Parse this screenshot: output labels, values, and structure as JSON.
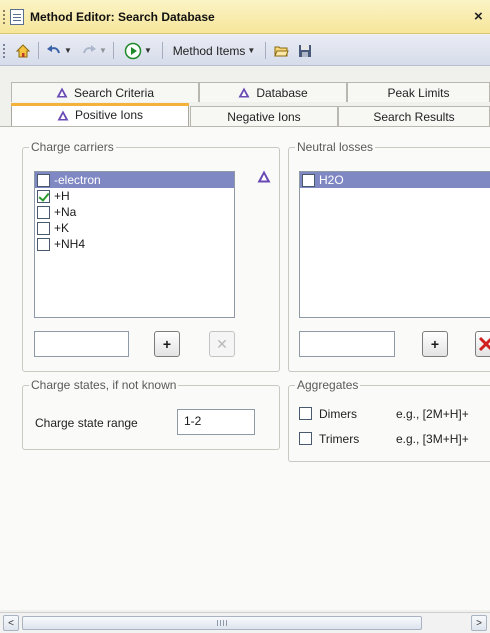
{
  "window": {
    "title": "Method Editor: Search Database",
    "close_glyph": "×"
  },
  "toolbar": {
    "method_items_label": "Method Items"
  },
  "tabs": {
    "row1": [
      {
        "label": "Search Criteria",
        "icon": "triangle-icon"
      },
      {
        "label": "Database",
        "icon": "triangle-icon"
      },
      {
        "label": "Peak Limits",
        "icon": ""
      }
    ],
    "row2": [
      {
        "label": "Positive Ions",
        "icon": "triangle-icon",
        "active": true
      },
      {
        "label": "Negative Ions",
        "icon": ""
      },
      {
        "label": "Search Results",
        "icon": ""
      }
    ]
  },
  "charge_carriers": {
    "legend": "Charge carriers",
    "items": [
      {
        "label": "-electron",
        "checked": false,
        "selected": true
      },
      {
        "label": "+H",
        "checked": true,
        "selected": false
      },
      {
        "label": "+Na",
        "checked": false,
        "selected": false
      },
      {
        "label": "+K",
        "checked": false,
        "selected": false
      },
      {
        "label": "+NH4",
        "checked": false,
        "selected": false
      }
    ],
    "input_value": "",
    "add_glyph": "+",
    "delete_glyph": "✕"
  },
  "neutral_losses": {
    "legend": "Neutral losses",
    "items": [
      {
        "label": "H2O",
        "checked": false,
        "selected": true
      }
    ],
    "input_value": "",
    "add_glyph": "+"
  },
  "charge_states": {
    "legend": "Charge states, if not known",
    "range_label": "Charge state range",
    "range_value": "1-2"
  },
  "aggregates": {
    "legend": "Aggregates",
    "dimers_label": "Dimers",
    "dimers_example": "e.g., [2M+H]+",
    "trimers_label": "Trimers",
    "trimers_example": "e.g., [3M+H]+"
  },
  "scrollbar": {
    "left_glyph": "<",
    "right_glyph": ">"
  },
  "colors": {
    "accent_tab": "#f2b23b",
    "selection": "#8088c4",
    "warning_triangle": "#6a4ab5"
  }
}
